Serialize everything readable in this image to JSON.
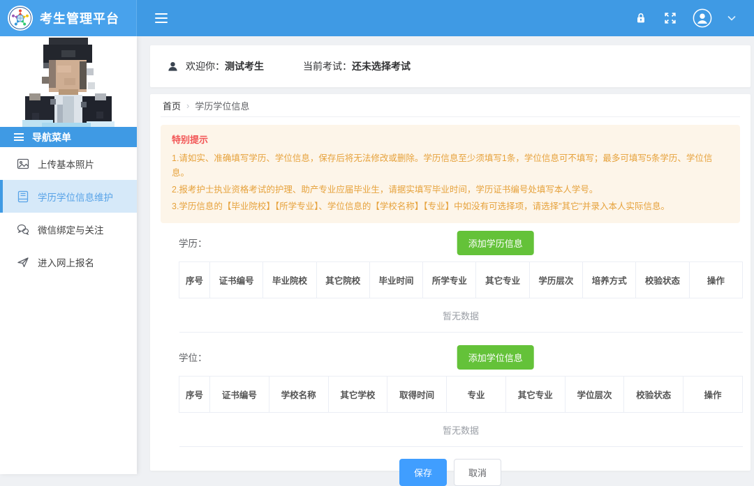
{
  "header": {
    "app_title": "考生管理平台"
  },
  "sidebar": {
    "nav_title": "导航菜单",
    "items": [
      {
        "label": "上传基本照片",
        "icon": "image-icon",
        "active": false
      },
      {
        "label": "学历学位信息维护",
        "icon": "book-icon",
        "active": true
      },
      {
        "label": "微信绑定与关注",
        "icon": "wechat-icon",
        "active": false
      },
      {
        "label": "进入网上报名",
        "icon": "send-icon",
        "active": false
      }
    ]
  },
  "welcome": {
    "greeting_label": "欢迎你：",
    "candidate_name": "测试考生",
    "exam_label": "当前考试：",
    "exam_value": "还未选择考试"
  },
  "breadcrumb": {
    "home": "首页",
    "separator": "›",
    "current": "学历学位信息"
  },
  "notice": {
    "title": "特别提示",
    "lines": [
      "1.请如实、准确填写学历、学位信息，保存后将无法修改或删除。学历信息至少须填写1条，学位信息可不填写；最多可填写5条学历、学位信息。",
      "2.报考护士执业资格考试的护理、助产专业应届毕业生，请据实填写毕业时间，学历证书编号处填写本人学号。",
      "3.学历信息的【毕业院校】【所学专业】、学位信息的【学校名称】【专业】中如没有可选择项，请选择\"其它\"并录入本人实际信息。"
    ]
  },
  "education": {
    "label": "学历：",
    "add_button": "添加学历信息",
    "columns": [
      "序号",
      "证书编号",
      "毕业院校",
      "其它院校",
      "毕业时间",
      "所学专业",
      "其它专业",
      "学历层次",
      "培养方式",
      "校验状态",
      "操作"
    ],
    "empty_text": "暂无数据"
  },
  "degree": {
    "label": "学位：",
    "add_button": "添加学位信息",
    "columns": [
      "序号",
      "证书编号",
      "学校名称",
      "其它学校",
      "取得时间",
      "专业",
      "其它专业",
      "学位层次",
      "校验状态",
      "操作"
    ],
    "empty_text": "暂无数据"
  },
  "footer": {
    "save_label": "保存",
    "cancel_label": "取消"
  },
  "colors": {
    "header_blue": "#3f9ae4",
    "active_menu_blue": "#d6e9f9",
    "success_green": "#64c239",
    "save_blue": "#409eff",
    "notice_bg": "#fdf5e9",
    "notice_text_orange": "#e6a23c",
    "notice_title_red": "#f25555"
  }
}
